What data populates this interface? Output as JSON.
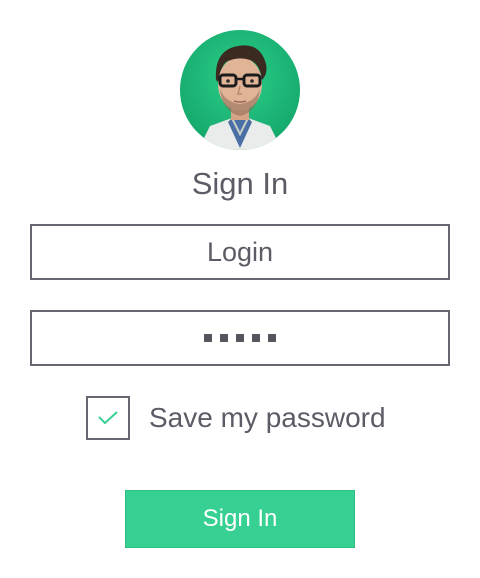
{
  "colors": {
    "accent": "#36d092",
    "avatar_bg": "#1eb87a",
    "border": "#676772",
    "text": "#5c5c66"
  },
  "avatar": {
    "icon": "user-avatar-photo"
  },
  "title": "Sign In",
  "login": {
    "placeholder": "Login",
    "value": ""
  },
  "password": {
    "masked_length": 5
  },
  "remember": {
    "label": "Save my password",
    "checked": true,
    "icon": "checkmark-icon"
  },
  "submit": {
    "label": "Sign In"
  }
}
